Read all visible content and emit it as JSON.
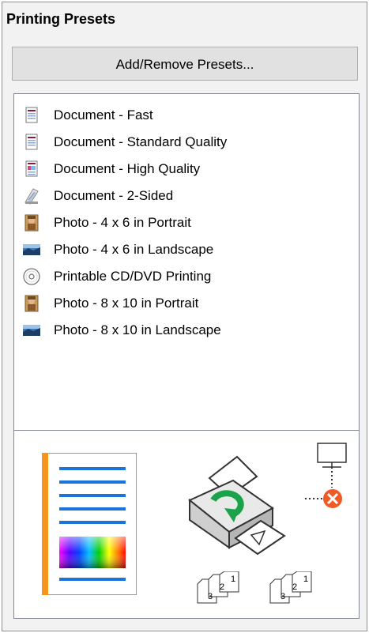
{
  "panel": {
    "title": "Printing Presets"
  },
  "toolbar": {
    "add_remove_label": "Add/Remove Presets..."
  },
  "presets": [
    {
      "label": "Document - Fast",
      "icon": "document-icon"
    },
    {
      "label": "Document - Standard Quality",
      "icon": "document-icon"
    },
    {
      "label": "Document - High Quality",
      "icon": "document-hq-icon"
    },
    {
      "label": "Document - 2-Sided",
      "icon": "document-2sided-icon"
    },
    {
      "label": "Photo - 4 x 6 in Portrait",
      "icon": "photo-portrait-icon"
    },
    {
      "label": "Photo - 4 x 6 in Landscape",
      "icon": "photo-landscape-icon"
    },
    {
      "label": "Printable CD/DVD Printing",
      "icon": "cd-dvd-icon"
    },
    {
      "label": "Photo - 8 x 10 in Portrait",
      "icon": "photo-portrait-icon"
    },
    {
      "label": "Photo - 8 x 10 in Landscape",
      "icon": "photo-landscape-icon"
    }
  ],
  "preview": {
    "collate_digits": [
      "1",
      "2",
      "3"
    ]
  },
  "colors": {
    "accent_orange": "#f7941d",
    "blue_line": "#1e74d6",
    "error_orange": "#f05a24",
    "green_arrow": "#1aa34a"
  }
}
